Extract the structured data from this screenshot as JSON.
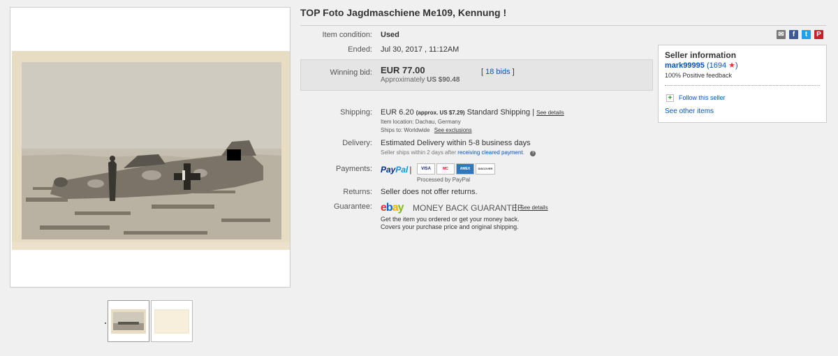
{
  "listing": {
    "title": "TOP Foto Jagdmaschiene Me109, Kennung !"
  },
  "details": {
    "condition_label": "Item condition:",
    "condition_value": "Used",
    "ended_label": "Ended:",
    "ended_value": "Jul 30, 2017 , 11:12AM",
    "winning_label": "Winning bid:",
    "winning_value": "EUR 77.00",
    "approx_prefix": "Approximately",
    "approx_value": "US $90.48",
    "bids_open": "[",
    "bids_link": "18 bids",
    "bids_close": "]",
    "shipping_label": "Shipping:",
    "shipping_value": "EUR 6.20",
    "shipping_approx": "(approx. US $7.29)",
    "shipping_method": "Standard Shipping |",
    "see_details": "See details",
    "item_location": "Item location:  Dachau, Germany",
    "ships_to_prefix": "Ships to:  Worldwide",
    "see_exclusions": "See exclusions",
    "delivery_label": "Delivery:",
    "delivery_value": "Estimated Delivery within 5-8 business days",
    "delivery_note_prefix": "Seller ships within 2 days after",
    "delivery_note_link": "receiving cleared payment",
    "delivery_note_suffix": ".",
    "help_icon": "?",
    "payments_label": "Payments:",
    "paypal_pay": "Pay",
    "paypal_pal": "Pal",
    "paypal_sep": "|",
    "processed_by": "Processed by PayPal",
    "cards": [
      "VISA",
      "MC",
      "AMEX",
      "DISCOVER"
    ],
    "returns_label": "Returns:",
    "returns_value": "Seller does not offer returns.",
    "guarantee_label": "Guarantee:",
    "ebay_letters": [
      "e",
      "b",
      "a",
      "y"
    ],
    "money_back": "MONEY BACK GUARANTEE",
    "guarantee_sep": "|",
    "guarantee_see_details": "See details",
    "guarantee_line1": "Get the item you ordered or get your money back.",
    "guarantee_line2": "Covers your purchase price and original shipping."
  },
  "share": {
    "icons": [
      "email-icon",
      "facebook-icon",
      "twitter-icon",
      "pinterest-icon"
    ],
    "glyphs": [
      "✉",
      "f",
      "t",
      "P"
    ]
  },
  "seller": {
    "title": "Seller information",
    "username": "mark99995",
    "score_open": "(",
    "score": "1694",
    "star": "★",
    "score_close": ")",
    "feedback": "100% Positive feedback",
    "follow_icon": "+",
    "follow": "Follow this seller",
    "see_other": "See other items"
  },
  "colors": {
    "link": "#0654ba",
    "ebay_e": "#e53238",
    "ebay_b": "#0064d2",
    "ebay_a": "#f5af02",
    "ebay_y": "#86b817",
    "star": "#e53238"
  }
}
